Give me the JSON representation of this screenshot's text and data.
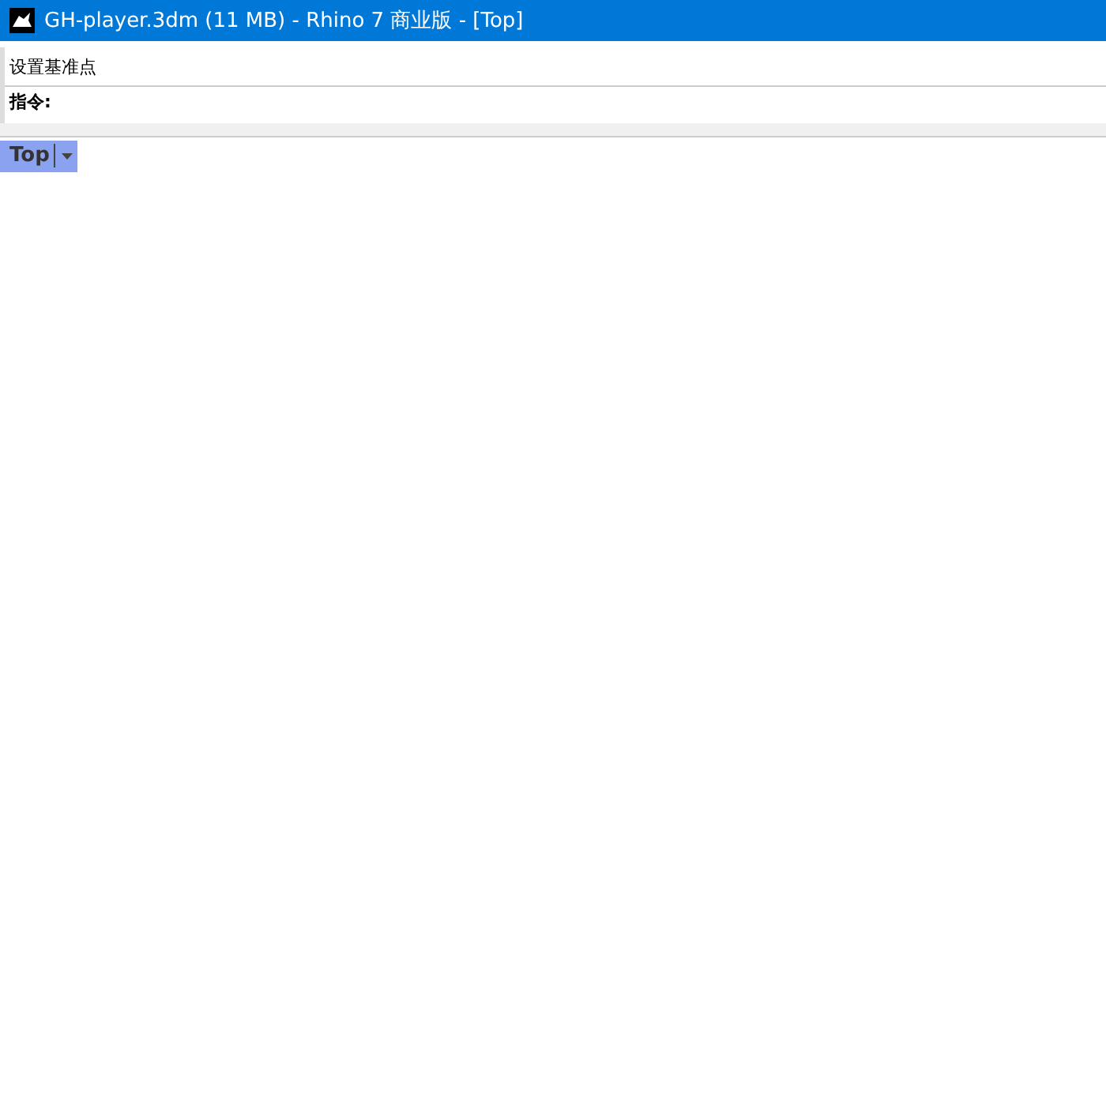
{
  "window": {
    "title": "GH-player.3dm (11 MB) - Rhino 7 商业版 - [Top]"
  },
  "command_area": {
    "history": [
      "设置基准点"
    ],
    "prompt": "指令:"
  },
  "viewport": {
    "tab": {
      "label": "Top",
      "selected": true
    }
  }
}
